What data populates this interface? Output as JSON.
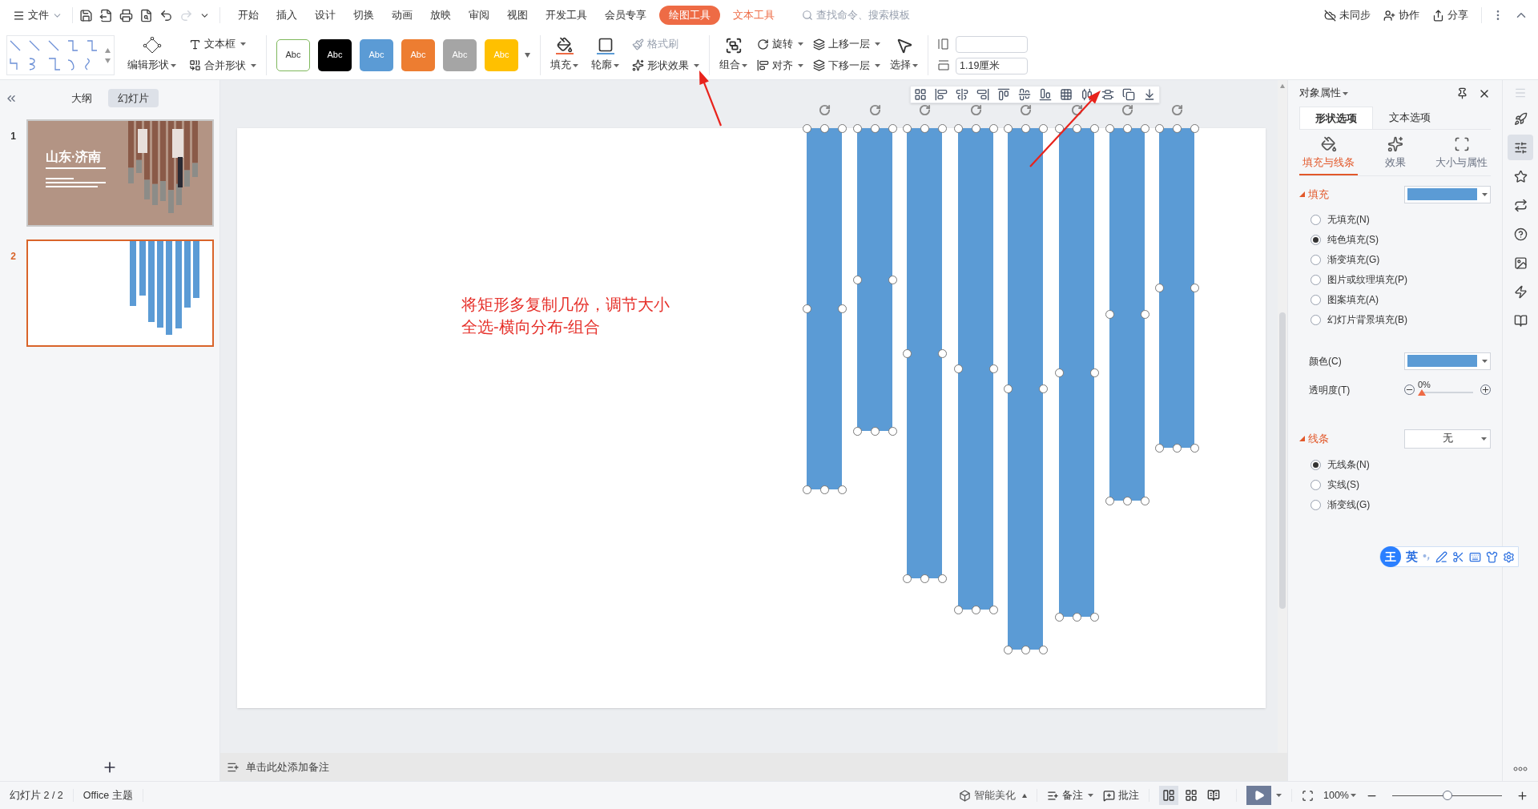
{
  "menu": {
    "file": "文件",
    "tabs": [
      {
        "label": "开始",
        "kind": "normal",
        "selected": false
      },
      {
        "label": "插入",
        "kind": "normal",
        "selected": false
      },
      {
        "label": "设计",
        "kind": "normal",
        "selected": false
      },
      {
        "label": "切换",
        "kind": "normal",
        "selected": false
      },
      {
        "label": "动画",
        "kind": "normal",
        "selected": false
      },
      {
        "label": "放映",
        "kind": "normal",
        "selected": false
      },
      {
        "label": "审阅",
        "kind": "normal",
        "selected": false
      },
      {
        "label": "视图",
        "kind": "normal",
        "selected": false
      },
      {
        "label": "开发工具",
        "kind": "normal",
        "selected": false
      },
      {
        "label": "会员专享",
        "kind": "normal",
        "selected": false
      },
      {
        "label": "绘图工具",
        "kind": "context",
        "selected": true
      },
      {
        "label": "文本工具",
        "kind": "context",
        "selected": false
      }
    ],
    "search": {
      "placeholder": "查找命令、搜索模板"
    },
    "actions": [
      "未同步",
      "协作",
      "分享"
    ]
  },
  "ribbon": {
    "edit_shape": "编辑形状",
    "text_box": "文本框",
    "merge_shape": "合并形状",
    "swatches": [
      {
        "label": "Abc",
        "color": "#ffffff"
      },
      {
        "label": "Abc",
        "color": "#000000"
      },
      {
        "label": "Abc",
        "color": "#5b9bd5"
      },
      {
        "label": "Abc",
        "color": "#ed7d31"
      },
      {
        "label": "Abc",
        "color": "#a5a5a5"
      },
      {
        "label": "Abc",
        "color": "#ffc000"
      }
    ],
    "fill": "填充",
    "outline": "轮廓",
    "format_painter": {
      "label": "格式刷",
      "disabled": true
    },
    "shape_effect": "形状效果",
    "group": "组合",
    "rotate": "旋转",
    "align": "对齐",
    "bring_forward": "上移一层",
    "send_backward": "下移一层",
    "select": "选择",
    "width_value": "1.19厘米"
  },
  "left_panel": {
    "tabs": [
      {
        "label": "大纲",
        "selected": false
      },
      {
        "label": "幻灯片",
        "selected": true
      }
    ],
    "slides": [
      {
        "number": "1",
        "selected": false,
        "title": "山东·济南"
      },
      {
        "number": "2",
        "selected": true
      }
    ]
  },
  "slide": {
    "instructions": [
      "将矩形多复制几份，调节大小",
      "全选-横向分布-组合"
    ],
    "shapes": [
      {
        "kind": "rectangle",
        "selected": true
      },
      {
        "kind": "rectangle",
        "selected": true
      },
      {
        "kind": "rectangle",
        "selected": true
      },
      {
        "kind": "rectangle",
        "selected": true
      },
      {
        "kind": "rectangle",
        "selected": true
      },
      {
        "kind": "rectangle",
        "selected": true
      },
      {
        "kind": "rectangle",
        "selected": true
      },
      {
        "kind": "rectangle",
        "selected": true
      }
    ]
  },
  "notes": {
    "placeholder": "单击此处添加备注"
  },
  "properties": {
    "title": "对象属性",
    "tabs": [
      {
        "label": "形状选项",
        "selected": true
      },
      {
        "label": "文本选项",
        "selected": false
      }
    ],
    "subtabs": [
      {
        "label": "填充与线条",
        "selected": true
      },
      {
        "label": "效果",
        "selected": false
      },
      {
        "label": "大小与属性",
        "selected": false
      }
    ],
    "fill": {
      "heading": "填充",
      "expanded": true,
      "color": "#5b9bd5",
      "options": [
        {
          "label": "无填充(N)",
          "selected": false
        },
        {
          "label": "纯色填充(S)",
          "selected": true
        },
        {
          "label": "渐变填充(G)",
          "selected": false
        },
        {
          "label": "图片或纹理填充(P)",
          "selected": false
        },
        {
          "label": "图案填充(A)",
          "selected": false
        },
        {
          "label": "幻灯片背景填充(B)",
          "selected": false
        }
      ]
    },
    "color": {
      "label": "颜色(C)",
      "color": "#5b9bd5"
    },
    "transparency": {
      "label": "透明度(T)",
      "reading": "0%",
      "level": 0
    },
    "line": {
      "heading": "线条",
      "expanded": true,
      "value": "无",
      "options": [
        {
          "label": "无线条(N)",
          "selected": true
        },
        {
          "label": "实线(S)",
          "selected": false
        },
        {
          "label": "渐变线(G)",
          "selected": false
        }
      ]
    }
  },
  "ime": {
    "logo": "王",
    "mode": "英"
  },
  "status": {
    "slide": "幻灯片 2 / 2",
    "theme": "Office 主题",
    "beautify": "智能美化",
    "notes": "备注",
    "comments": "批注",
    "views": [
      {
        "kind": "normal",
        "selected": true
      },
      {
        "kind": "sorter",
        "selected": false
      },
      {
        "kind": "reading",
        "selected": false
      }
    ],
    "zoom": {
      "reading": "100%",
      "level": 0.5
    }
  }
}
